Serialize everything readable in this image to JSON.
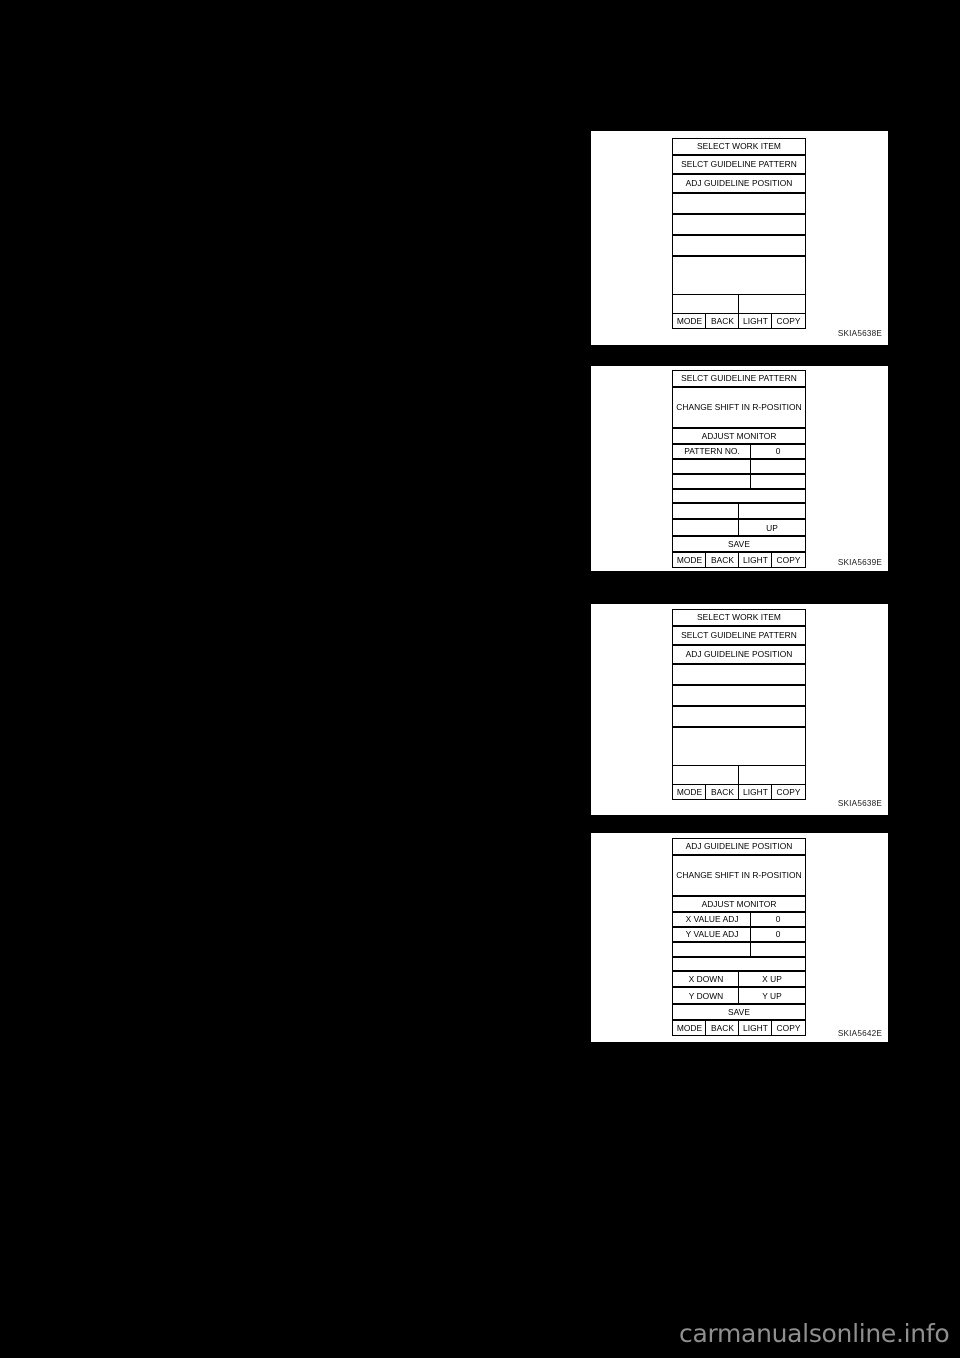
{
  "page": {
    "background_color": "#000000",
    "watermark": "carmanualsonline.info",
    "watermark_color": "#8f8f8f"
  },
  "figures": [
    {
      "code": "SKIA5638E",
      "screen": {
        "title": "SELECT WORK ITEM",
        "items": [
          "SELCT GUIDELINE PATTERN",
          "ADJ GUIDELINE POSITION",
          "",
          "",
          "",
          ""
        ],
        "softkeys": [
          "MODE",
          "BACK",
          "LIGHT",
          "COPY"
        ]
      }
    },
    {
      "code": "SKIA5639E",
      "screen": {
        "title": "SELCT GUIDELINE PATTERN",
        "message": "CHANGE SHIFT IN R-POSITION",
        "monitor_header": "ADJUST MONITOR",
        "monitor_rows": [
          {
            "label": "PATTERN NO.",
            "value": "0"
          },
          {
            "label": "",
            "value": ""
          },
          {
            "label": "",
            "value": ""
          }
        ],
        "spacer": "",
        "controls": [
          {
            "left": "",
            "right": ""
          },
          {
            "left": "",
            "right": "UP"
          }
        ],
        "save": "SAVE",
        "softkeys": [
          "MODE",
          "BACK",
          "LIGHT",
          "COPY"
        ]
      }
    },
    {
      "code": "SKIA5638E",
      "screen": {
        "title": "SELECT WORK ITEM",
        "items": [
          "SELCT GUIDELINE PATTERN",
          "ADJ GUIDELINE POSITION",
          "",
          "",
          "",
          ""
        ],
        "softkeys": [
          "MODE",
          "BACK",
          "LIGHT",
          "COPY"
        ]
      }
    },
    {
      "code": "SKIA5642E",
      "screen": {
        "title": "ADJ GUIDELINE POSITION",
        "message": "CHANGE SHIFT IN R-POSITION",
        "monitor_header": "ADJUST MONITOR",
        "monitor_rows": [
          {
            "label": "X VALUE ADJ",
            "value": "0"
          },
          {
            "label": "Y VALUE ADJ",
            "value": "0"
          },
          {
            "label": "",
            "value": ""
          }
        ],
        "spacer": "",
        "controls": [
          {
            "left": "X DOWN",
            "right": "X UP"
          },
          {
            "left": "Y DOWN",
            "right": "Y UP"
          }
        ],
        "save": "SAVE",
        "softkeys": [
          "MODE",
          "BACK",
          "LIGHT",
          "COPY"
        ]
      }
    }
  ]
}
